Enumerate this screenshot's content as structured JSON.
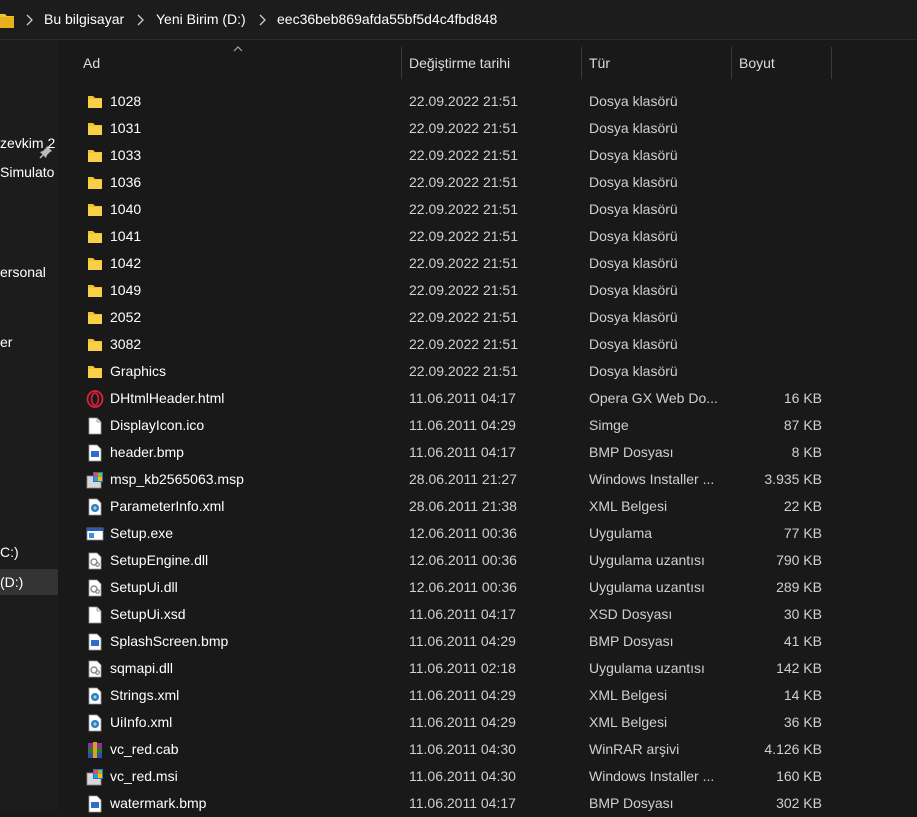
{
  "breadcrumb": {
    "items": [
      "Bu bilgisayar",
      "Yeni Birim (D:)",
      "eec36beb869afda55bf5d4c4fbd848"
    ]
  },
  "nav": {
    "items": [
      {
        "label": "zevkim 2",
        "selected": false
      },
      {
        "label": "Simulato",
        "selected": false
      },
      {
        "label": "ersonal",
        "selected": false
      },
      {
        "label": "er",
        "selected": false
      },
      {
        "label": "C:)",
        "selected": false
      },
      {
        "label": "(D:)",
        "selected": true
      }
    ]
  },
  "columns": {
    "name": "Ad",
    "date": "Değiştirme tarihi",
    "type": "Tür",
    "size": "Boyut"
  },
  "colors": {
    "background": "#191919",
    "folder": "#f4c22b",
    "selected": "#333333"
  },
  "files": [
    {
      "name": "1028",
      "date": "22.09.2022 21:51",
      "type": "Dosya klasörü",
      "size": "",
      "icon": "folder-icon"
    },
    {
      "name": "1031",
      "date": "22.09.2022 21:51",
      "type": "Dosya klasörü",
      "size": "",
      "icon": "folder-icon"
    },
    {
      "name": "1033",
      "date": "22.09.2022 21:51",
      "type": "Dosya klasörü",
      "size": "",
      "icon": "folder-icon"
    },
    {
      "name": "1036",
      "date": "22.09.2022 21:51",
      "type": "Dosya klasörü",
      "size": "",
      "icon": "folder-icon"
    },
    {
      "name": "1040",
      "date": "22.09.2022 21:51",
      "type": "Dosya klasörü",
      "size": "",
      "icon": "folder-icon"
    },
    {
      "name": "1041",
      "date": "22.09.2022 21:51",
      "type": "Dosya klasörü",
      "size": "",
      "icon": "folder-icon"
    },
    {
      "name": "1042",
      "date": "22.09.2022 21:51",
      "type": "Dosya klasörü",
      "size": "",
      "icon": "folder-icon"
    },
    {
      "name": "1049",
      "date": "22.09.2022 21:51",
      "type": "Dosya klasörü",
      "size": "",
      "icon": "folder-icon"
    },
    {
      "name": "2052",
      "date": "22.09.2022 21:51",
      "type": "Dosya klasörü",
      "size": "",
      "icon": "folder-icon"
    },
    {
      "name": "3082",
      "date": "22.09.2022 21:51",
      "type": "Dosya klasörü",
      "size": "",
      "icon": "folder-icon"
    },
    {
      "name": "Graphics",
      "date": "22.09.2022 21:51",
      "type": "Dosya klasörü",
      "size": "",
      "icon": "folder-icon"
    },
    {
      "name": "DHtmlHeader.html",
      "date": "11.06.2011 04:17",
      "type": "Opera GX Web Do...",
      "size": "16 KB",
      "icon": "opera-gx-icon"
    },
    {
      "name": "DisplayIcon.ico",
      "date": "11.06.2011 04:29",
      "type": "Simge",
      "size": "87 KB",
      "icon": "blank-file-icon"
    },
    {
      "name": "header.bmp",
      "date": "11.06.2011 04:17",
      "type": "BMP Dosyası",
      "size": "8 KB",
      "icon": "bmp-file-icon"
    },
    {
      "name": "msp_kb2565063.msp",
      "date": "28.06.2011 21:27",
      "type": "Windows Installer ...",
      "size": "3.935 KB",
      "icon": "installer-icon"
    },
    {
      "name": "ParameterInfo.xml",
      "date": "28.06.2011 21:38",
      "type": "XML Belgesi",
      "size": "22 KB",
      "icon": "xml-file-icon"
    },
    {
      "name": "Setup.exe",
      "date": "12.06.2011 00:36",
      "type": "Uygulama",
      "size": "77 KB",
      "icon": "exe-icon"
    },
    {
      "name": "SetupEngine.dll",
      "date": "12.06.2011 00:36",
      "type": "Uygulama uzantısı",
      "size": "790 KB",
      "icon": "dll-file-icon"
    },
    {
      "name": "SetupUi.dll",
      "date": "12.06.2011 00:36",
      "type": "Uygulama uzantısı",
      "size": "289 KB",
      "icon": "dll-file-icon"
    },
    {
      "name": "SetupUi.xsd",
      "date": "11.06.2011 04:17",
      "type": "XSD Dosyası",
      "size": "30 KB",
      "icon": "blank-file-icon"
    },
    {
      "name": "SplashScreen.bmp",
      "date": "11.06.2011 04:29",
      "type": "BMP Dosyası",
      "size": "41 KB",
      "icon": "bmp-file-icon"
    },
    {
      "name": "sqmapi.dll",
      "date": "11.06.2011 02:18",
      "type": "Uygulama uzantısı",
      "size": "142 KB",
      "icon": "dll-file-icon"
    },
    {
      "name": "Strings.xml",
      "date": "11.06.2011 04:29",
      "type": "XML Belgesi",
      "size": "14 KB",
      "icon": "xml-file-icon"
    },
    {
      "name": "UiInfo.xml",
      "date": "11.06.2011 04:29",
      "type": "XML Belgesi",
      "size": "36 KB",
      "icon": "xml-file-icon"
    },
    {
      "name": "vc_red.cab",
      "date": "11.06.2011 04:30",
      "type": "WinRAR arşivi",
      "size": "4.126 KB",
      "icon": "winrar-icon"
    },
    {
      "name": "vc_red.msi",
      "date": "11.06.2011 04:30",
      "type": "Windows Installer ...",
      "size": "160 KB",
      "icon": "installer-icon"
    },
    {
      "name": "watermark.bmp",
      "date": "11.06.2011 04:17",
      "type": "BMP Dosyası",
      "size": "302 KB",
      "icon": "bmp-file-icon"
    }
  ]
}
